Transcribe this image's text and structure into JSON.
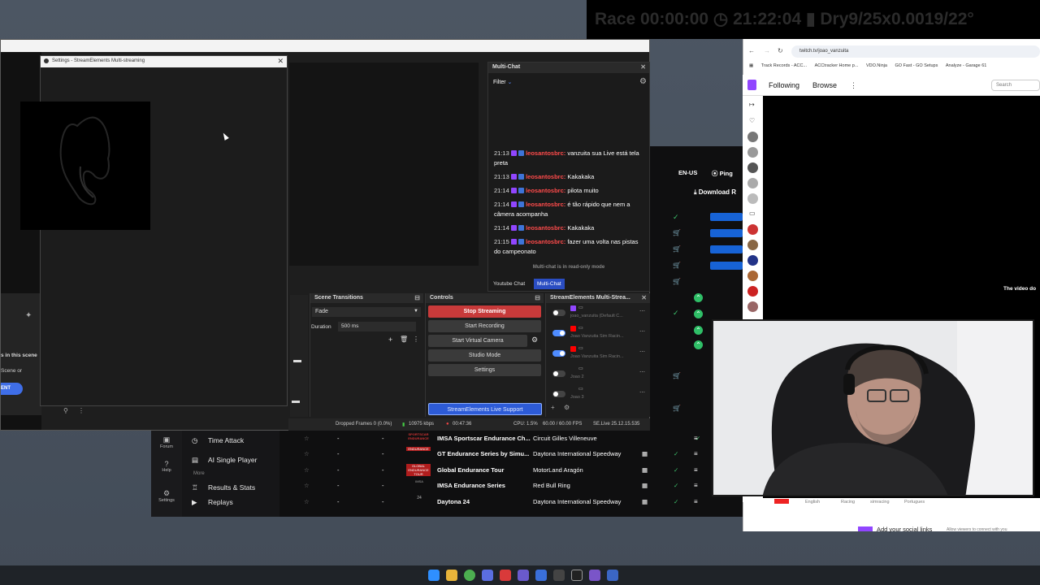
{
  "overlay": {
    "text": "Race 00:00:00 ◷ 21:22:04 ▮ Dry9/25x0.0019/22°"
  },
  "settings": {
    "title": "Settings - StreamElements Multi-streaming"
  },
  "left_panel": {
    "line1": "s in this scene",
    "line2": "Scene or",
    "button": "ENT"
  },
  "multichat": {
    "title": "Multi-Chat",
    "filter": "Filter",
    "messages": [
      {
        "time": "21:13",
        "user": "leosantosbrc:",
        "text": "vanzuita sua Live está tela preta"
      },
      {
        "time": "21:13",
        "user": "leosantosbrc:",
        "text": "Kakakaka"
      },
      {
        "time": "21:14",
        "user": "leosantosbrc:",
        "text": "pilota muito"
      },
      {
        "time": "21:14",
        "user": "leosantosbrc:",
        "text": "é tão rápido que nem a câmera acompanha"
      },
      {
        "time": "21:14",
        "user": "leosantosbrc:",
        "text": "Kakakaka"
      },
      {
        "time": "21:15",
        "user": "leosantosbrc:",
        "text": "fazer uma volta nas pistas do campeonato"
      }
    ],
    "readonly": "Multi-chat is in read-only mode",
    "tabs": [
      "Youtube Chat",
      "Multi-Chat"
    ]
  },
  "scene_transitions": {
    "title": "Scene Transitions",
    "transition": "Fade",
    "duration_label": "Duration",
    "duration_value": "500 ms"
  },
  "controls": {
    "title": "Controls",
    "buttons": [
      "Stop Streaming",
      "Start Recording",
      "Start Virtual Camera",
      "Studio Mode",
      "Settings"
    ],
    "support": "StreamElements Live Support"
  },
  "multistream": {
    "title": "StreamElements Multi-Strea...",
    "items": [
      {
        "name": "joao_vanzuita (Default C...",
        "on": false,
        "color": "#9146ff"
      },
      {
        "name": "Joao Vanzuita Sim Racin...",
        "on": true,
        "color": "#ff0000"
      },
      {
        "name": "Joao Vanzuita Sim Racin...",
        "on": true,
        "color": "#ff0000"
      },
      {
        "name": "Joao 2",
        "on": false,
        "color": ""
      },
      {
        "name": "Joao 3",
        "on": false,
        "color": ""
      }
    ]
  },
  "statusbar": {
    "dropped": "Dropped Frames 0 (0.0%)",
    "bitrate": "10975 kbps",
    "time": "00:47:36",
    "cpu": "CPU: 1.5%",
    "fps": "60.00 / 60.00 FPS",
    "version": "SE.Live 25.12.15.535"
  },
  "race": {
    "lang": "EN-US",
    "ping": "Ping",
    "download": "Download R",
    "sidebar": [
      "Forum",
      "Help",
      "Settings"
    ],
    "menu": [
      "Time Attack",
      "AI Single Player",
      "More",
      "Results & Stats",
      "Replays"
    ],
    "rows": [
      {
        "series": "IMSA Sportscar Endurance Ch...",
        "track": "Circuit Gilles Villeneuve",
        "logo": "SPORTSCAR ENDURANCE"
      },
      {
        "series": "GT Endurance Series by Simu...",
        "track": "Daytona International Speedway",
        "logo": "ENDURANCE"
      },
      {
        "series": "Global Endurance Tour",
        "track": "MotorLand Aragón",
        "logo": "GLOBAL ENDURANCE TOUR"
      },
      {
        "series": "IMSA Endurance Series",
        "track": "Red Bull Ring",
        "logo": "IMSA"
      },
      {
        "series": "Daytona 24",
        "track": "Daytona International Speedway",
        "logo": "24"
      }
    ],
    "dash": "-"
  },
  "browser": {
    "url": "twitch.tv/joao_vanzuita",
    "bookmarks": [
      "Track Records - ACC...",
      "ACCtracker Home p...",
      "VDO.Ninja",
      "GO Fast - GO Setups",
      "Analyze - Garage 61"
    ],
    "nav": [
      "Following",
      "Browse"
    ],
    "search_placeholder": "Search",
    "video_text": "The video do",
    "tags": [
      "English",
      "Racing",
      "simracing",
      "Portugues"
    ],
    "social": "Add your social links",
    "social_sub": "Allow viewers to connect with you"
  },
  "colors": {
    "accent_red": "#c83a3a",
    "twitch_purple": "#9146ff",
    "race_blue": "#1763d6",
    "ok_green": "#2fbf67"
  }
}
